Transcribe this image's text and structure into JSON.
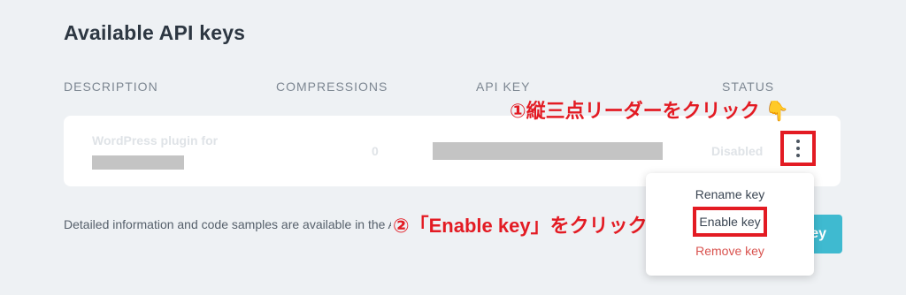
{
  "section": {
    "title": "Available API keys"
  },
  "columns": {
    "description": "DESCRIPTION",
    "compressions": "COMPRESSIONS",
    "api_key": "API KEY",
    "status": "STATUS"
  },
  "row": {
    "description": "WordPress plugin for",
    "compressions": "0",
    "status": "Disabled"
  },
  "annotations": {
    "step1": "①縦三点リーダーをクリック",
    "step2": "②「Enable key」をクリック",
    "hand_icon": "👇"
  },
  "footer": {
    "text": "Detailed information and code samples are available in the API reference.",
    "add_button": "key"
  },
  "menu": {
    "rename": "Rename key",
    "enable": "Enable key",
    "remove": "Remove key"
  },
  "colors": {
    "accent": "#3fbad0",
    "annotation": "#e31b23",
    "danger": "#d9534f"
  }
}
